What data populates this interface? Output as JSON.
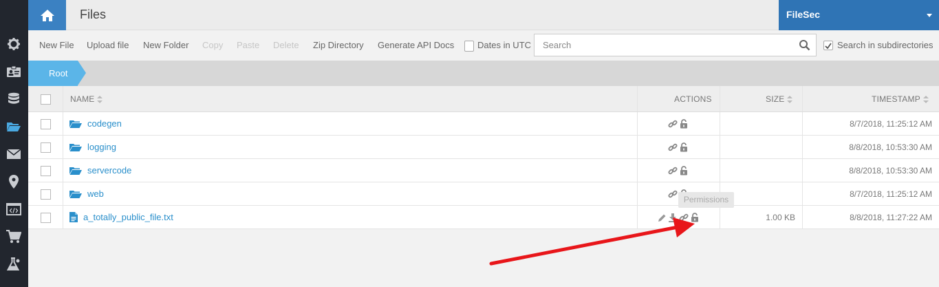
{
  "header": {
    "title": "Files"
  },
  "app_menu": {
    "label": "FileSec"
  },
  "toolbar": {
    "new_file": "New File",
    "upload_file": "Upload file",
    "new_folder": "New Folder",
    "copy": "Copy",
    "paste": "Paste",
    "delete": "Delete",
    "zip_directory": "Zip Directory",
    "generate_api_docs": "Generate API Docs",
    "dates_in_utc": "Dates in UTC",
    "dates_in_utc_checked": false,
    "search_placeholder": "Search",
    "search_value": "",
    "search_subdirs": "Search in subdirectories",
    "search_subdirs_checked": true
  },
  "breadcrumb": {
    "root": "Root"
  },
  "table": {
    "columns": {
      "name": "NAME",
      "actions": "ACTIONS",
      "size": "SIZE",
      "timestamp": "TIMESTAMP"
    },
    "rows": [
      {
        "type": "folder",
        "name": "codegen",
        "size": "",
        "timestamp": "8/7/2018, 11:25:12 AM"
      },
      {
        "type": "folder",
        "name": "logging",
        "size": "",
        "timestamp": "8/8/2018, 10:53:30 AM"
      },
      {
        "type": "folder",
        "name": "servercode",
        "size": "",
        "timestamp": "8/8/2018, 10:53:30 AM"
      },
      {
        "type": "folder",
        "name": "web",
        "size": "",
        "timestamp": "8/7/2018, 11:25:12 AM"
      },
      {
        "type": "file",
        "name": "a_totally_public_file.txt",
        "size": "1.00 KB",
        "timestamp": "8/8/2018, 11:27:22 AM"
      }
    ]
  },
  "tooltip": {
    "text": "Permissions"
  },
  "sidebar": {
    "icons": [
      "gear-icon",
      "id-card-icon",
      "database-icon",
      "folder-open-icon",
      "envelope-icon",
      "map-marker-icon",
      "code-window-icon",
      "cart-icon",
      "flask-icon"
    ],
    "active": "folder-open-icon"
  },
  "colors": {
    "brand": "#2f74b5",
    "home": "#3b81c2",
    "crumb": "#5bb5e8",
    "link": "#2a8fcb",
    "annotation_arrow": "#e8161a"
  }
}
